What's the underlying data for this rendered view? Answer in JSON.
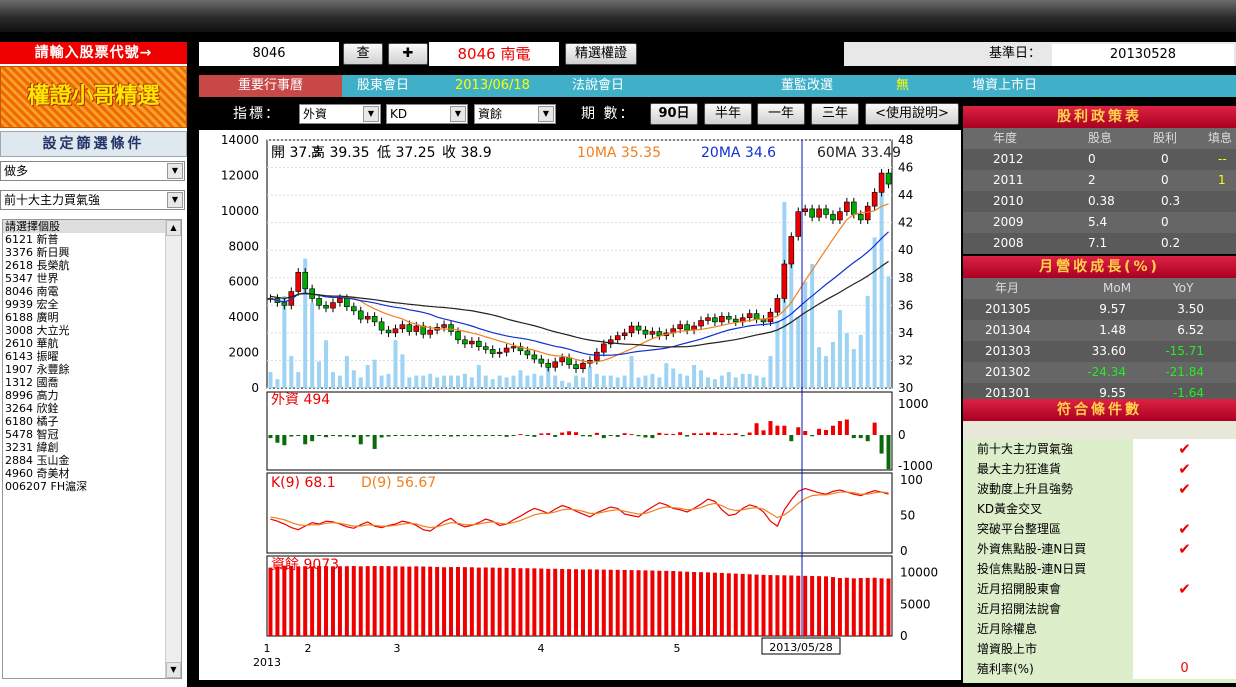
{
  "left": {
    "input_prompt": "請輸入股票代號→",
    "logo": "權證小哥精選",
    "filter_header": "設定篩選條件",
    "select1": "做多",
    "select2": "前十大主力買氣強",
    "stocks": [
      "請選擇個股",
      "6121 新普",
      "3376 新日興",
      "2618 長榮航",
      "5347 世界",
      "8046 南電",
      "9939 宏全",
      "6188 廣明",
      "3008 大立光",
      "2610 華航",
      "6143 振曜",
      "1907 永豐餘",
      "1312 國喬",
      "8996 高力",
      "3264 欣銓",
      "6180 橘子",
      "5478 智冠",
      "3231 緯創",
      "2884 玉山金",
      "4960 奇美材",
      "006207 FH滬深"
    ]
  },
  "toolbar": {
    "code": "8046",
    "query_label": "查",
    "add_label": "✚",
    "stock_name": "8046 南電",
    "warrant_label": "精選權證",
    "base_date_label": "基準日：",
    "base_date": "20130528"
  },
  "info": {
    "events_label": "重要行事曆",
    "agm_label": "股東會日",
    "agm_date": "2013/06/18",
    "conf_label": "法說會日",
    "board_label": "董監改選",
    "board_value": "無",
    "issue_label": "增資上市日"
  },
  "controls": {
    "indicator_label": "指標：",
    "ind1": "外資",
    "ind2": "KD",
    "ind3": "資餘",
    "period_label": "期 數：",
    "p90": "90日",
    "phalf": "半年",
    "p1y": "一年",
    "p3y": "三年",
    "help": "<使用說明>"
  },
  "chart_data": {
    "type": "candlestick",
    "ohlc_text": {
      "open": "開 37.3",
      "high": "高 39.35",
      "low": "低 37.25",
      "close": "收 38.9"
    },
    "ma10": "10MA 35.35",
    "ma20": "20MA 34.6",
    "ma60": "60MA 33.49",
    "price_axis": [
      30,
      32,
      34,
      36,
      38,
      40,
      42,
      44,
      46,
      48
    ],
    "volume_axis": [
      0,
      2000,
      4000,
      6000,
      8000,
      10000,
      12000,
      14000
    ],
    "price_ylim": [
      30,
      48
    ],
    "volume_ylim": [
      0,
      14000
    ],
    "foreign_label": "外資 494",
    "foreign_axis": [
      1000,
      0,
      -1000
    ],
    "kd_label_k": "K(9) 68.1",
    "kd_label_d": "D(9) 56.67",
    "kd_axis": [
      100,
      50,
      0
    ],
    "margin_label": "資餘 9073",
    "margin_axis": [
      10000,
      5000,
      0
    ],
    "x_ticks": [
      "1",
      "2",
      "3",
      "4",
      "5"
    ],
    "x_year": "2013",
    "cursor_date": "2013/05/28",
    "closes": [
      36.5,
      36.2,
      36,
      37,
      38.4,
      37.2,
      36.5,
      36,
      35.8,
      36.2,
      36.5,
      35.9,
      35.6,
      35,
      35.2,
      34.8,
      34.2,
      34,
      34.3,
      34.6,
      34.1,
      34.5,
      33.9,
      34.2,
      34.4,
      34.6,
      34.1,
      33.5,
      33.2,
      33.4,
      33,
      32.8,
      32.5,
      32.6,
      32.9,
      33,
      32.7,
      32.4,
      32.1,
      31.8,
      31.5,
      31.9,
      32.2,
      31.7,
      31.4,
      31.8,
      32,
      32.6,
      33.2,
      33.5,
      33.8,
      34,
      34.5,
      34.2,
      33.9,
      34.1,
      33.8,
      34,
      34.3,
      34.6,
      34.2,
      34.5,
      34.9,
      35.1,
      34.8,
      35.2,
      35,
      34.8,
      35.1,
      35.4,
      35,
      34.8,
      35.5,
      36.5,
      39,
      41,
      42.8,
      43,
      42.4,
      43,
      42.6,
      42.2,
      42.8,
      43.5,
      42.6,
      42.2,
      43.2,
      44.2,
      45.6,
      44.8
    ],
    "volumes": [
      900,
      500,
      5200,
      1800,
      900,
      7300,
      4800,
      1500,
      2700,
      900,
      700,
      1800,
      1000,
      600,
      1300,
      1600,
      700,
      800,
      2700,
      1900,
      600,
      700,
      700,
      800,
      600,
      700,
      700,
      700,
      800,
      600,
      1300,
      700,
      500,
      700,
      600,
      700,
      1000,
      700,
      800,
      700,
      1300,
      700,
      400,
      300,
      700,
      600,
      1200,
      800,
      700,
      700,
      600,
      700,
      1800,
      600,
      700,
      800,
      600,
      1400,
      1100,
      800,
      700,
      1300,
      1000,
      600,
      500,
      700,
      900,
      600,
      800,
      800,
      700,
      600,
      1800,
      3800,
      10500,
      8400,
      4000,
      6000,
      7000,
      2300,
      1800,
      2600,
      4400,
      3100,
      2200,
      3000,
      5200,
      8500,
      11800,
      6300
    ],
    "foreign": [
      -100,
      -250,
      -330,
      -50,
      -30,
      -300,
      -200,
      -30,
      -70,
      -20,
      -50,
      -40,
      -70,
      -300,
      -50,
      -450,
      -80,
      -50,
      -30,
      -20,
      -30,
      -20,
      -30,
      -40,
      -30,
      -20,
      -50,
      -40,
      -20,
      -30,
      -40,
      -20,
      -30,
      -30,
      -60,
      -20,
      30,
      -20,
      -60,
      50,
      60,
      -60,
      80,
      120,
      90,
      -40,
      -50,
      70,
      -100,
      -30,
      -60,
      60,
      30,
      -40,
      -80,
      -100,
      70,
      40,
      30,
      90,
      -50,
      60,
      50,
      80,
      90,
      40,
      40,
      60,
      -40,
      80,
      380,
      150,
      450,
      300,
      300,
      -200,
      250,
      130,
      -40,
      200,
      160,
      300,
      450,
      500,
      -100,
      -100,
      -200,
      400,
      -600,
      -1100,
      -200,
      1200,
      -500,
      350,
      -30,
      -50
    ],
    "k": [
      45,
      42,
      38,
      33,
      30,
      35,
      40,
      38,
      42,
      41,
      38,
      34,
      32,
      37,
      41,
      35,
      33,
      36,
      38,
      42,
      40,
      36,
      30,
      28,
      35,
      42,
      46,
      38,
      34,
      36,
      40,
      45,
      42,
      36,
      38,
      44,
      49,
      55,
      60,
      57,
      53,
      59,
      64,
      61,
      56,
      52,
      48,
      54,
      58,
      62,
      60,
      52,
      50,
      48,
      56,
      62,
      68,
      65,
      60,
      58,
      55,
      60,
      66,
      73,
      70,
      58,
      50,
      52,
      60,
      65,
      62,
      55,
      42,
      35,
      58,
      72,
      84,
      88,
      85,
      82,
      80,
      84,
      86,
      83,
      80,
      78,
      82,
      85,
      83,
      80
    ],
    "d": [
      48,
      46,
      44,
      40,
      37,
      36,
      37,
      37,
      39,
      40,
      39,
      37,
      35,
      35,
      37,
      36,
      35,
      35,
      36,
      38,
      39,
      38,
      35,
      33,
      34,
      37,
      40,
      39,
      37,
      37,
      38,
      40,
      41,
      39,
      38,
      40,
      43,
      47,
      51,
      53,
      53,
      55,
      58,
      59,
      58,
      56,
      53,
      53,
      55,
      57,
      58,
      56,
      54,
      52,
      53,
      56,
      60,
      62,
      61,
      60,
      58,
      59,
      61,
      65,
      67,
      64,
      59,
      57,
      58,
      60,
      61,
      59,
      53,
      47,
      51,
      58,
      67,
      74,
      78,
      79,
      79,
      81,
      83,
      83,
      82,
      80,
      80,
      82,
      83,
      82
    ],
    "margin": [
      10800,
      11000,
      11100,
      11050,
      11000,
      11020,
      11000,
      11050,
      11030,
      11000,
      11010,
      11020,
      11050,
      11000,
      11030,
      11050,
      11040,
      11030,
      11000,
      10980,
      10960,
      11000,
      10970,
      10950,
      10900,
      10850,
      10880,
      10900,
      10870,
      10850,
      10800,
      10820,
      10800,
      10780,
      10760,
      10740,
      10700,
      10700,
      10680,
      10650,
      10600,
      10620,
      10580,
      10560,
      10540,
      10500,
      10520,
      10500,
      10480,
      10460,
      10450,
      10430,
      10400,
      10380,
      10360,
      10340,
      10300,
      10280,
      10260,
      10200,
      10150,
      10100,
      10080,
      10050,
      10000,
      9950,
      9900,
      9850,
      9800,
      9750,
      9700,
      9650,
      9620,
      9600,
      9580,
      9560,
      9520,
      9500,
      9480,
      9450,
      9420,
      9300,
      9150,
      9200,
      9100,
      9150,
      9180,
      9200,
      9100,
      9073
    ]
  },
  "dividend": {
    "title": "股利政策表",
    "headers": [
      "年度",
      "股息",
      "股利",
      "填息"
    ],
    "rows": [
      {
        "year": "2012",
        "cash": "0",
        "stock": "0",
        "fill": "--"
      },
      {
        "year": "2011",
        "cash": "2",
        "stock": "0",
        "fill": "1"
      },
      {
        "year": "2010",
        "cash": "0.38",
        "stock": "0.3",
        "fill": ""
      },
      {
        "year": "2009",
        "cash": "5.4",
        "stock": "0",
        "fill": ""
      },
      {
        "year": "2008",
        "cash": "7.1",
        "stock": "0.2",
        "fill": ""
      }
    ]
  },
  "revenue": {
    "title": "月營收成長(%)",
    "headers": [
      "年月",
      "MoM",
      "YoY"
    ],
    "rows": [
      {
        "ym": "201305",
        "mom": "9.57",
        "yoy": "3.50"
      },
      {
        "ym": "201304",
        "mom": "1.48",
        "yoy": "6.52"
      },
      {
        "ym": "201303",
        "mom": "33.60",
        "yoy": "-15.71"
      },
      {
        "ym": "201302",
        "mom": "-24.34",
        "yoy": "-21.84"
      },
      {
        "ym": "201301",
        "mom": "9.55",
        "yoy": "-1.64"
      }
    ],
    "colors": {
      "neg": "#22ee22",
      "pos": "#ffffff"
    }
  },
  "conditions": {
    "title": "符合條件數",
    "items": [
      {
        "name": "前十大主力買氣強",
        "mark": "✔"
      },
      {
        "name": "最大主力狂進貨",
        "mark": "✔"
      },
      {
        "name": "波動度上升且強勢",
        "mark": "✔"
      },
      {
        "name": "KD黃金交叉",
        "mark": ""
      },
      {
        "name": "突破平台整理區",
        "mark": "✔"
      },
      {
        "name": "外資焦點股-連N日買",
        "mark": "✔"
      },
      {
        "name": "投信焦點股-連N日買",
        "mark": ""
      },
      {
        "name": "近月招開股東會",
        "mark": "✔"
      },
      {
        "name": "近月招開法說會",
        "mark": ""
      },
      {
        "name": "近月除權息",
        "mark": ""
      },
      {
        "name": "增資股上市",
        "mark": ""
      },
      {
        "name": "殖利率(%)",
        "mark": "0"
      }
    ]
  }
}
